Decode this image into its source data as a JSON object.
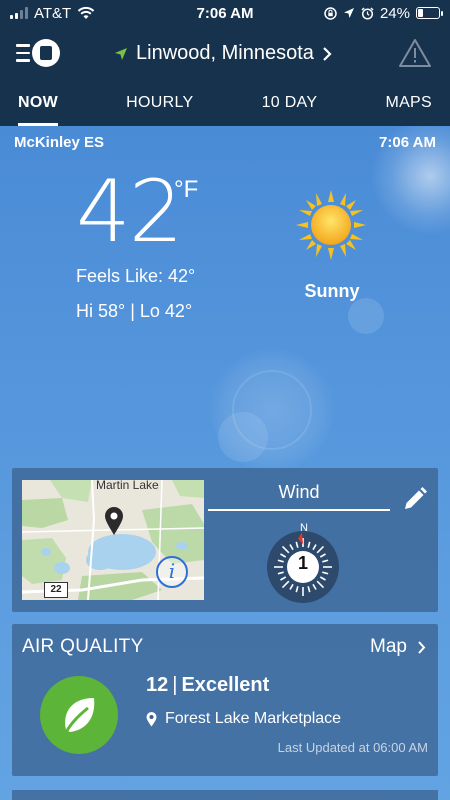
{
  "status_bar": {
    "carrier": "AT&T",
    "time": "7:06 AM",
    "battery_percent": "24%",
    "battery_level": 0.24,
    "icons": [
      "signal-icon",
      "wifi-icon",
      "screen-lock-icon",
      "location-arrow-icon",
      "alarm-icon",
      "battery-icon"
    ]
  },
  "header": {
    "location": "Linwood, Minnesota",
    "icons": [
      "menu-icon",
      "app-logo-icon",
      "location-arrow-icon",
      "chevron-right-icon",
      "alert-triangle-icon"
    ]
  },
  "tabs": [
    {
      "label": "NOW",
      "active": true
    },
    {
      "label": "HOURLY",
      "active": false
    },
    {
      "label": "10 DAY",
      "active": false
    },
    {
      "label": "MAPS",
      "active": false
    }
  ],
  "current": {
    "station": "McKinley ES",
    "obs_time": "7:06 AM",
    "temperature": "42",
    "unit": "°F",
    "feels_like": "Feels Like: 42°",
    "hi_lo": "Hi 58° | Lo 42°",
    "condition": "Sunny",
    "condition_icon": "sun-icon"
  },
  "map_card": {
    "map_label": "Martin Lake",
    "road_number": "22",
    "wind_title": "Wind",
    "compass_north": "N",
    "wind_speed": "1",
    "icons": [
      "map-pin-icon",
      "info-icon",
      "pencil-icon",
      "compass-icon"
    ]
  },
  "air_quality": {
    "title": "AIR QUALITY",
    "map_link": "Map",
    "index": "12",
    "separator": "|",
    "rating": "Excellent",
    "location": "Forest Lake Marketplace",
    "updated": "Last Updated at 06:00 AM",
    "icons": [
      "leaf-icon",
      "location-pin-icon",
      "chevron-right-icon"
    ]
  },
  "colors": {
    "header_bg": "#17324d",
    "sky_top": "#4a8bd6",
    "card_bg": "#3a5f8c",
    "accent_green": "#7cc242",
    "aq_green": "#5cb438",
    "info_blue": "#2f6fd8"
  }
}
